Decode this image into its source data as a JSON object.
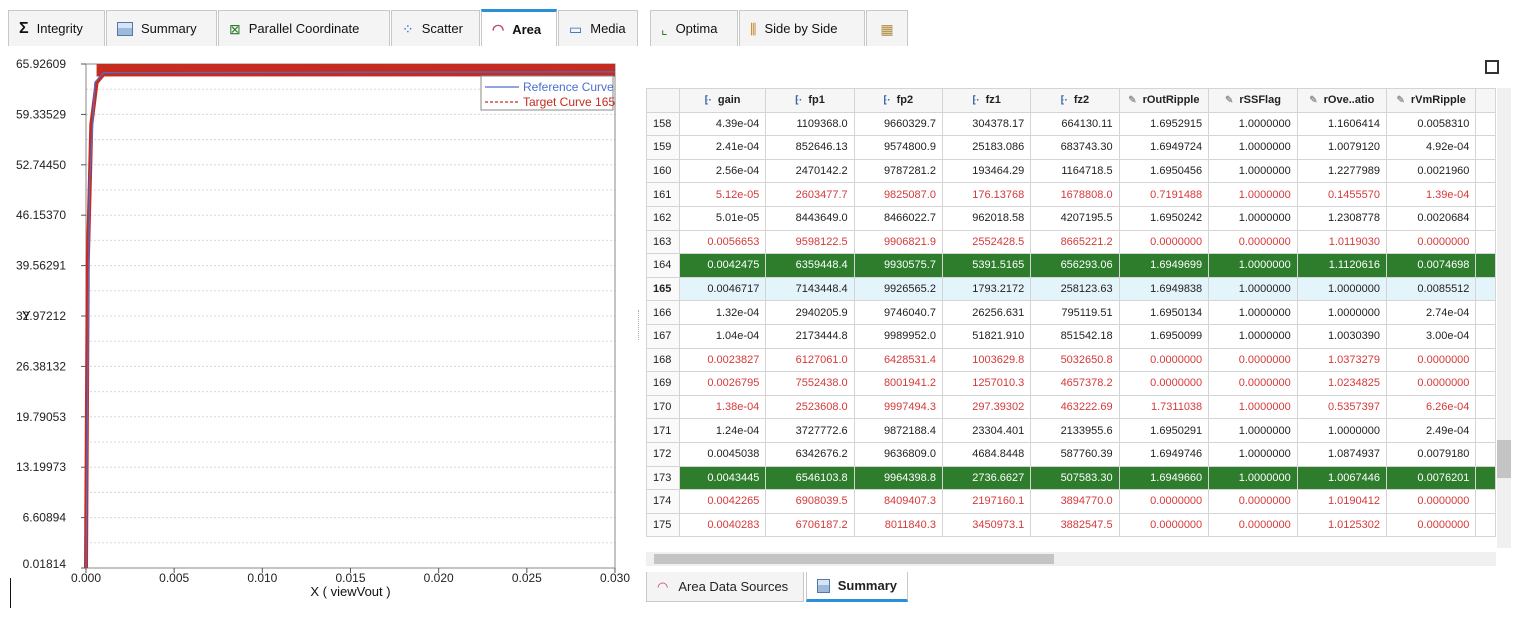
{
  "tabs": [
    {
      "label": "Integrity",
      "icon": "sigma-icon",
      "glyph": "Σ"
    },
    {
      "label": "Summary",
      "icon": "summary-table-icon",
      "glyph": ""
    },
    {
      "label": "Parallel Coordinate",
      "icon": "parallel-coordinate-icon",
      "glyph": "⊠"
    },
    {
      "label": "Scatter",
      "icon": "scatter-icon",
      "glyph": "⁘"
    },
    {
      "label": "Area",
      "icon": "area-icon",
      "glyph": "◠"
    },
    {
      "label": "Media",
      "icon": "media-monitor-icon",
      "glyph": "▭"
    },
    {
      "label": "Optima",
      "icon": "optima-icon",
      "glyph": "⌞"
    },
    {
      "label": "Side by Side",
      "icon": "side-by-side-icon",
      "glyph": "⫼"
    },
    {
      "label": "",
      "icon": "grid-tab-icon",
      "glyph": "▦"
    }
  ],
  "chart_data": {
    "type": "area",
    "xlabel": "X ( viewVout )",
    "ylabel": "Y",
    "xlim": [
      0.0,
      0.03
    ],
    "ylim": [
      0.01814,
      65.92609
    ],
    "x_ticks": [
      "0.000",
      "0.005",
      "0.010",
      "0.015",
      "0.020",
      "0.025",
      "0.030"
    ],
    "y_ticks": [
      "0.01814",
      "6.60894",
      "13.19973",
      "19.79053",
      "26.38132",
      "32.97212",
      "39.56291",
      "46.15370",
      "52.74450",
      "59.33529",
      "65.92609"
    ],
    "legend_position": "top-right",
    "series": [
      {
        "name": "Reference Curve",
        "color": "#4a6fd1",
        "style": "solid",
        "x": [
          0.0,
          0.0002,
          0.0005,
          0.001,
          0.03
        ],
        "y": [
          0.01814,
          50.0,
          63.5,
          64.8,
          64.9
        ]
      },
      {
        "name": "Target Curve 165",
        "color": "#c62b20",
        "style": "dashed",
        "x": [
          0.0,
          0.0001,
          0.0003,
          0.0006,
          0.001,
          0.03
        ],
        "y": [
          0.01814,
          40.0,
          58.0,
          63.5,
          64.6,
          64.9
        ],
        "band": [
          64.3,
          65.926
        ]
      }
    ]
  },
  "table": {
    "columns": [
      "gain",
      "fp1",
      "fp2",
      "fz1",
      "fz2",
      "rOutRipple",
      "rSSFlag",
      "rOve..atio",
      "rVmRipple"
    ],
    "rows": [
      {
        "id": "158",
        "style": "normal",
        "cells": [
          "4.39e-04",
          "1109368.0",
          "9660329.7",
          "304378.17",
          "664130.11",
          "1.6952915",
          "1.0000000",
          "1.1606414",
          "0.0058310"
        ]
      },
      {
        "id": "159",
        "style": "normal",
        "cells": [
          "2.41e-04",
          "852646.13",
          "9574800.9",
          "25183.086",
          "683743.30",
          "1.6949724",
          "1.0000000",
          "1.0079120",
          "4.92e-04"
        ]
      },
      {
        "id": "160",
        "style": "normal",
        "cells": [
          "2.56e-04",
          "2470142.2",
          "9787281.2",
          "193464.29",
          "1164718.5",
          "1.6950456",
          "1.0000000",
          "1.2277989",
          "0.0021960"
        ]
      },
      {
        "id": "161",
        "style": "red",
        "cells": [
          "5.12e-05",
          "2603477.7",
          "9825087.0",
          "176.13768",
          "1678808.0",
          "0.7191488",
          "1.0000000",
          "0.1455570",
          "1.39e-04"
        ]
      },
      {
        "id": "162",
        "style": "normal",
        "cells": [
          "5.01e-05",
          "8443649.0",
          "8466022.7",
          "962018.58",
          "4207195.5",
          "1.6950242",
          "1.0000000",
          "1.2308778",
          "0.0020684"
        ]
      },
      {
        "id": "163",
        "style": "red",
        "cells": [
          "0.0056653",
          "9598122.5",
          "9906821.9",
          "2552428.5",
          "8665221.2",
          "0.0000000",
          "0.0000000",
          "1.0119030",
          "0.0000000"
        ]
      },
      {
        "id": "164",
        "style": "green",
        "cells": [
          "0.0042475",
          "6359448.4",
          "9930575.7",
          "5391.5165",
          "656293.06",
          "1.6949699",
          "1.0000000",
          "1.1120616",
          "0.0074698"
        ]
      },
      {
        "id": "165",
        "style": "sel",
        "cells": [
          "0.0046717",
          "7143448.4",
          "9926565.2",
          "1793.2172",
          "258123.63",
          "1.6949838",
          "1.0000000",
          "1.0000000",
          "0.0085512"
        ]
      },
      {
        "id": "166",
        "style": "normal",
        "cells": [
          "1.32e-04",
          "2940205.9",
          "9746040.7",
          "26256.631",
          "795119.51",
          "1.6950134",
          "1.0000000",
          "1.0000000",
          "2.74e-04"
        ]
      },
      {
        "id": "167",
        "style": "normal",
        "cells": [
          "1.04e-04",
          "2173444.8",
          "9989952.0",
          "51821.910",
          "851542.18",
          "1.6950099",
          "1.0000000",
          "1.0030390",
          "3.00e-04"
        ]
      },
      {
        "id": "168",
        "style": "red",
        "cells": [
          "0.0023827",
          "6127061.0",
          "6428531.4",
          "1003629.8",
          "5032650.8",
          "0.0000000",
          "0.0000000",
          "1.0373279",
          "0.0000000"
        ]
      },
      {
        "id": "169",
        "style": "red",
        "cells": [
          "0.0026795",
          "7552438.0",
          "8001941.2",
          "1257010.3",
          "4657378.2",
          "0.0000000",
          "0.0000000",
          "1.0234825",
          "0.0000000"
        ]
      },
      {
        "id": "170",
        "style": "red",
        "cells": [
          "1.38e-04",
          "2523608.0",
          "9997494.3",
          "297.39302",
          "463222.69",
          "1.7311038",
          "1.0000000",
          "0.5357397",
          "6.26e-04"
        ]
      },
      {
        "id": "171",
        "style": "normal",
        "cells": [
          "1.24e-04",
          "3727772.6",
          "9872188.4",
          "23304.401",
          "2133955.6",
          "1.6950291",
          "1.0000000",
          "1.0000000",
          "2.49e-04"
        ]
      },
      {
        "id": "172",
        "style": "normal",
        "cells": [
          "0.0045038",
          "6342676.2",
          "9636809.0",
          "4684.8448",
          "587760.39",
          "1.6949746",
          "1.0000000",
          "1.0874937",
          "0.0079180"
        ]
      },
      {
        "id": "173",
        "style": "green",
        "cells": [
          "0.0043445",
          "6546103.8",
          "9964398.8",
          "2736.6627",
          "507583.30",
          "1.6949660",
          "1.0000000",
          "1.0067446",
          "0.0076201"
        ]
      },
      {
        "id": "174",
        "style": "red",
        "cells": [
          "0.0042265",
          "6908039.5",
          "8409407.3",
          "2197160.1",
          "3894770.0",
          "0.0000000",
          "0.0000000",
          "1.0190412",
          "0.0000000"
        ]
      },
      {
        "id": "175",
        "style": "red",
        "cells": [
          "0.0040283",
          "6706187.2",
          "8011840.3",
          "3450973.1",
          "3882547.5",
          "0.0000000",
          "0.0000000",
          "1.0125302",
          "0.0000000"
        ]
      }
    ]
  },
  "bottom_tabs": [
    {
      "label": "Area Data Sources",
      "icon": "area-icon"
    },
    {
      "label": "Summary",
      "icon": "summary-table-icon"
    }
  ]
}
